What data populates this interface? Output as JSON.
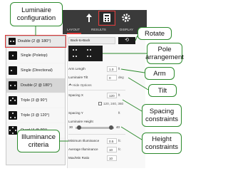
{
  "callouts": {
    "luminaire_configuration": "Luminaire configuration",
    "rotate": "Rotate",
    "pole_arrangement": "Pole arrangement",
    "arm": "Arm",
    "tilt": "Tilt",
    "spacing_constraints": "Spacing constraints",
    "height_constraints": "Height constraints",
    "illuminance_criteria": "Illuminance criteria"
  },
  "tabs": {
    "layout": "LAYOUT",
    "results": "RESULTS",
    "display": "DISPLAY"
  },
  "config_dropdown": {
    "selected": "Double (2 @ 180°)",
    "items": [
      "Single (Poletop)",
      "Single (Directional)",
      "Double (2 @ 180°)",
      "Triple (3 @ 90°)",
      "Triple (3 @ 120°)",
      "Quad (4 @ 90°)"
    ],
    "active_index": 2
  },
  "form": {
    "arrangement_select": "Back-to-Back",
    "rotate_symbol": "⟲",
    "arm_length_label": "Arm Length",
    "arm_length_value": "1.0",
    "arm_length_unit": "ft",
    "tilt_label": "Luminaire Tilt",
    "tilt_value": "0",
    "tilt_unit": "deg",
    "hide_options": "Hide Options",
    "spacing_x_label": "Spacing X",
    "spacing_x_value": "120",
    "spacing_x_unit": "ft",
    "spacing_x_range": "120, 240, 360",
    "spacing_y_label": "Spacing Y",
    "spacing_y_unit": "ft",
    "height_label": "Luminaire Height",
    "height_min": "30",
    "height_max": "40",
    "min_illum_label": "Minimum Illuminance",
    "min_illum_value": "0.5",
    "min_illum_unit": "fc",
    "avg_illum_label": "Average Illuminance",
    "avg_illum_value": "10",
    "avg_illum_unit": "fc",
    "maxmin_label": "Max/Min Ratio",
    "maxmin_value": "10"
  },
  "colors": {
    "callout_border": "#2c8a2c",
    "highlight_red": "#e03a3a",
    "dark_bar": "#3a3a3a"
  }
}
